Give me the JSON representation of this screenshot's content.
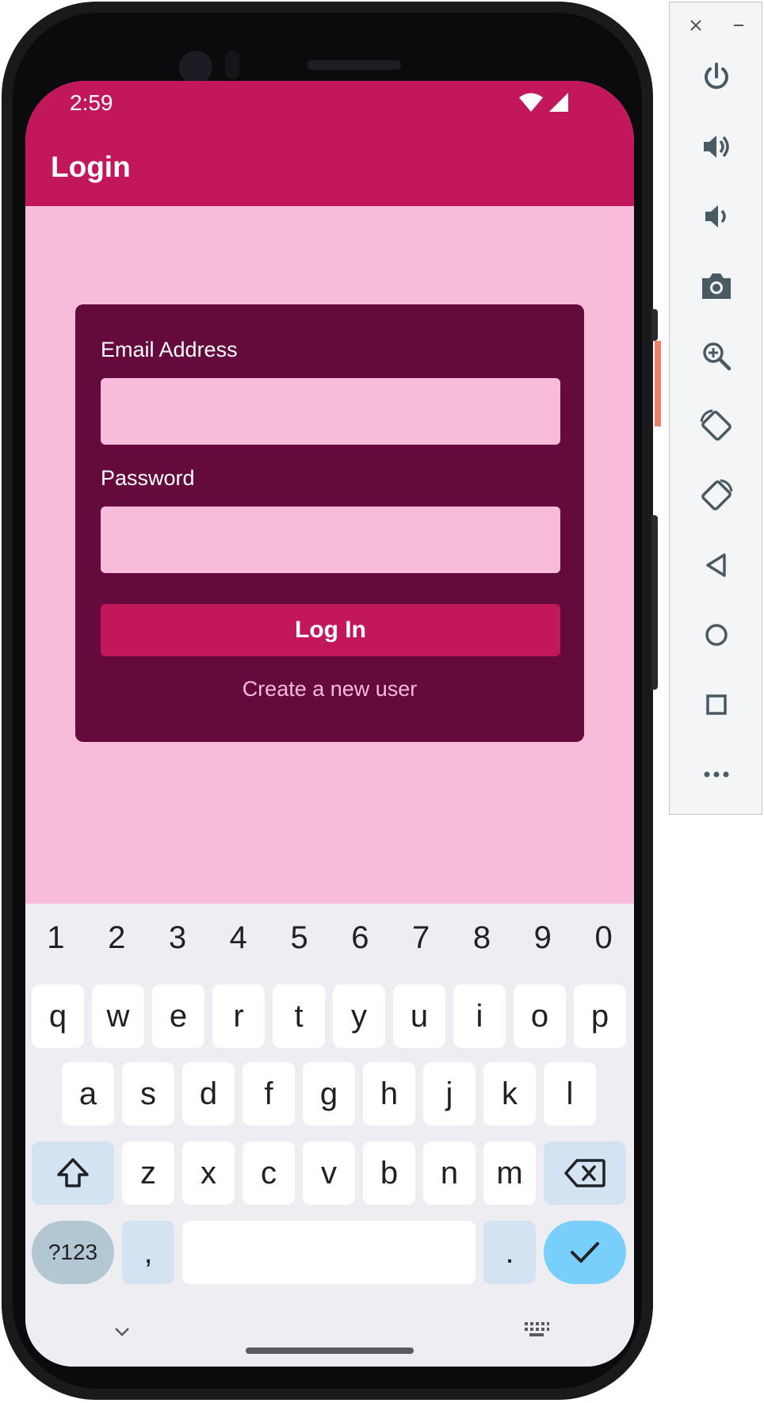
{
  "status_bar": {
    "time": "2:59"
  },
  "app_bar": {
    "title": "Login"
  },
  "login_card": {
    "email_label": "Email Address",
    "email_value": "",
    "password_label": "Password",
    "password_value": "",
    "login_button": "Log In",
    "create_user_link": "Create a new user"
  },
  "keyboard": {
    "number_row": [
      "1",
      "2",
      "3",
      "4",
      "5",
      "6",
      "7",
      "8",
      "9",
      "0"
    ],
    "row1": [
      "q",
      "w",
      "e",
      "r",
      "t",
      "y",
      "u",
      "i",
      "o",
      "p"
    ],
    "row2": [
      "a",
      "s",
      "d",
      "f",
      "g",
      "h",
      "j",
      "k",
      "l"
    ],
    "row3": [
      "z",
      "x",
      "c",
      "v",
      "b",
      "n",
      "m"
    ],
    "symbols_key": "?123",
    "comma_key": ",",
    "period_key": "."
  },
  "emulator_toolbar": {
    "items": [
      "power-icon",
      "volume-up-icon",
      "volume-down-icon",
      "camera-icon",
      "zoom-icon",
      "rotate-left-icon",
      "rotate-right-icon",
      "back-icon",
      "home-icon",
      "overview-icon",
      "more-icon"
    ]
  },
  "colors": {
    "primary": "#c2185b",
    "background": "#f8bbd9",
    "card": "#640a3d",
    "enter_key": "#79cffb"
  }
}
